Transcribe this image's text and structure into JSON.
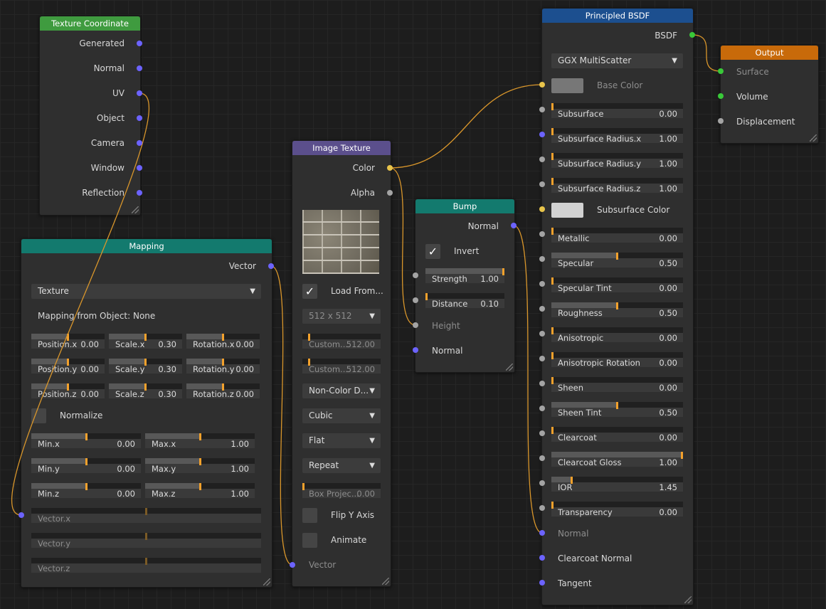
{
  "colors": {
    "header_texcoord": "#3f9b3f",
    "header_mapping": "#137a6e",
    "header_image": "#5b4f8c",
    "header_bump": "#137a6e",
    "header_bsdf": "#1c4f8f",
    "header_output": "#c86a0a",
    "wire": "#d9962b",
    "slider_marker": "#f3a12c"
  },
  "texture_coordinate": {
    "title": "Texture Coordinate",
    "outputs": [
      "Generated",
      "Normal",
      "UV",
      "Object",
      "Camera",
      "Window",
      "Reflection"
    ]
  },
  "mapping": {
    "title": "Mapping",
    "output": "Vector",
    "type": "Texture",
    "object_label": "Mapping from Object: None",
    "transform": [
      [
        {
          "label": "Position.x",
          "value": "0.00",
          "frac": 0.5
        },
        {
          "label": "Scale.x",
          "value": "0.30",
          "frac": 0.5
        },
        {
          "label": "Rotation.x",
          "value": "0.00",
          "frac": 0.5
        }
      ],
      [
        {
          "label": "Position.y",
          "value": "0.00",
          "frac": 0.5
        },
        {
          "label": "Scale.y",
          "value": "0.30",
          "frac": 0.5
        },
        {
          "label": "Rotation.y",
          "value": "0.00",
          "frac": 0.5
        }
      ],
      [
        {
          "label": "Position.z",
          "value": "0.00",
          "frac": 0.5
        },
        {
          "label": "Scale.z",
          "value": "0.30",
          "frac": 0.5
        },
        {
          "label": "Rotation.z",
          "value": "0.00",
          "frac": 0.5
        }
      ]
    ],
    "normalize_label": "Normalize",
    "minmax": [
      [
        {
          "label": "Min.x",
          "value": "0.00",
          "frac": 0.5
        },
        {
          "label": "Max.x",
          "value": "1.00",
          "frac": 0.5
        }
      ],
      [
        {
          "label": "Min.y",
          "value": "0.00",
          "frac": 0.5
        },
        {
          "label": "Max.y",
          "value": "1.00",
          "frac": 0.5
        }
      ],
      [
        {
          "label": "Min.z",
          "value": "0.00",
          "frac": 0.5
        },
        {
          "label": "Max.z",
          "value": "1.00",
          "frac": 0.5
        }
      ]
    ],
    "vector_inputs": [
      "Vector.x",
      "Vector.y",
      "Vector.z"
    ]
  },
  "image_texture": {
    "title": "Image Texture",
    "outputs": [
      "Color",
      "Alpha"
    ],
    "load_label": "Load From...",
    "resolution": "512 x 512",
    "custom1_label": "Custom...",
    "custom1_value": "512.00",
    "custom2_label": "Custom...",
    "custom2_value": "512.00",
    "color_space": "Non-Color D...",
    "interpolation": "Cubic",
    "projection": "Flat",
    "extension": "Repeat",
    "box_label": "Box Projec...",
    "box_value": "0.00",
    "flip_label": "Flip Y Axis",
    "animate_label": "Animate",
    "vector_input": "Vector"
  },
  "bump": {
    "title": "Bump",
    "output": "Normal",
    "invert_label": "Invert",
    "strength_label": "Strength",
    "strength_value": "1.00",
    "strength_frac": 1.0,
    "distance_label": "Distance",
    "distance_value": "0.10",
    "distance_frac": 0.0,
    "height_label": "Height",
    "normal_label": "Normal"
  },
  "bsdf": {
    "title": "Principled BSDF",
    "output": "BSDF",
    "distribution": "GGX MultiScatter",
    "base_color_label": "Base Color",
    "subsurface_color_label": "Subsurface Color",
    "sliders_a": [
      {
        "label": "Subsurface",
        "value": "0.00",
        "frac": 0.0
      },
      {
        "label": "Subsurface Radius.x",
        "value": "1.00",
        "frac": 0.0
      },
      {
        "label": "Subsurface Radius.y",
        "value": "1.00",
        "frac": 0.0
      },
      {
        "label": "Subsurface Radius.z",
        "value": "1.00",
        "frac": 0.0
      }
    ],
    "sliders_b": [
      {
        "label": "Metallic",
        "value": "0.00",
        "frac": 0.0
      },
      {
        "label": "Specular",
        "value": "0.50",
        "frac": 0.5
      },
      {
        "label": "Specular Tint",
        "value": "0.00",
        "frac": 0.0
      },
      {
        "label": "Roughness",
        "value": "0.50",
        "frac": 0.5
      },
      {
        "label": "Anisotropic",
        "value": "0.00",
        "frac": 0.0
      },
      {
        "label": "Anisotropic Rotation",
        "value": "0.00",
        "frac": 0.0
      },
      {
        "label": "Sheen",
        "value": "0.00",
        "frac": 0.0
      },
      {
        "label": "Sheen Tint",
        "value": "0.50",
        "frac": 0.5
      },
      {
        "label": "Clearcoat",
        "value": "0.00",
        "frac": 0.0
      },
      {
        "label": "Clearcoat Gloss",
        "value": "1.00",
        "frac": 1.0
      },
      {
        "label": "IOR",
        "value": "1.45",
        "frac": 0.15
      },
      {
        "label": "Transparency",
        "value": "0.00",
        "frac": 0.0
      }
    ],
    "inputs_bottom": [
      "Normal",
      "Clearcoat Normal",
      "Tangent"
    ]
  },
  "output": {
    "title": "Output",
    "inputs": [
      "Surface",
      "Volume",
      "Displacement"
    ]
  }
}
